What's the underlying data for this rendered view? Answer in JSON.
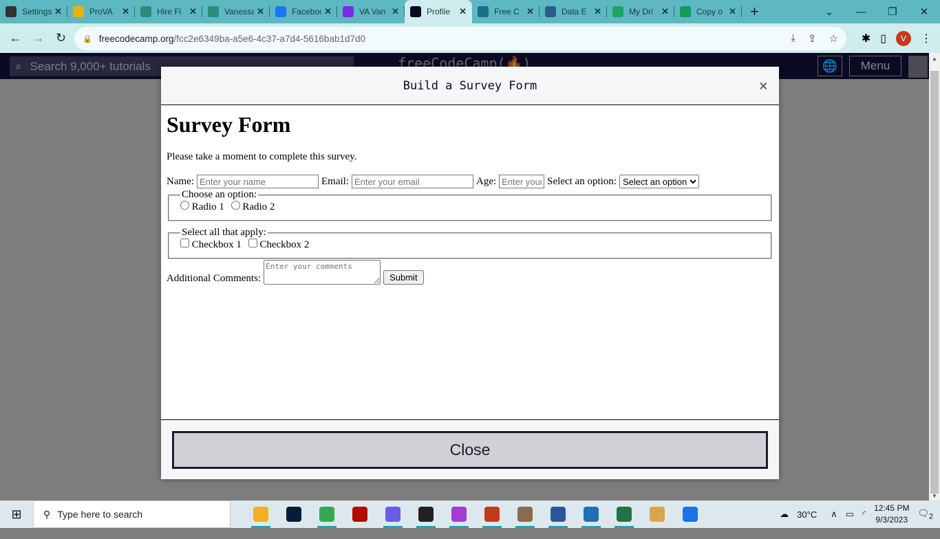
{
  "browser": {
    "tabs": [
      {
        "label": "Settings",
        "icon": "gear-icon",
        "color": "#333"
      },
      {
        "label": "ProVA",
        "icon": "prova-icon",
        "color": "#e8b400"
      },
      {
        "label": "Hire Fi",
        "icon": "pen-icon",
        "color": "#2a8c7a"
      },
      {
        "label": "Vanessa",
        "icon": "pen-icon",
        "color": "#2a8c7a"
      },
      {
        "label": "Facebook",
        "icon": "facebook-icon",
        "color": "#1877f2"
      },
      {
        "label": "VA Van",
        "icon": "canva-icon",
        "color": "#7d2ae8"
      },
      {
        "label": "Profile",
        "icon": "freecodecamp-icon",
        "color": "#0a0a23",
        "active": true
      },
      {
        "label": "Free C",
        "icon": "cisco-icon",
        "color": "#1b6f86"
      },
      {
        "label": "Data E",
        "icon": "data-icon",
        "color": "#2a5d8a"
      },
      {
        "label": "My Dri",
        "icon": "google-drive-icon",
        "color": "#1fa463"
      },
      {
        "label": "Copy o",
        "icon": "google-sheets-icon",
        "color": "#0f9d58"
      }
    ],
    "close_glyph": "✕",
    "new_tab": "+",
    "url_domain": "freecodecamp.org",
    "url_path": "/fcc2e6349ba-a5e6-4c37-a7d4-5616bab1d7d0",
    "profile_initial": "V"
  },
  "fcc_nav": {
    "search_placeholder": "Search 9,000+ tutorials",
    "logo": "freeCodeCamp(🔥)",
    "menu": "Menu"
  },
  "modal": {
    "title": "Build a Survey Form",
    "close_x": "×",
    "close_button": "Close",
    "form": {
      "heading": "Survey Form",
      "description": "Please take a moment to complete this survey.",
      "name_label": "Name:",
      "name_placeholder": "Enter your name",
      "email_label": "Email:",
      "email_placeholder": "Enter your email",
      "age_label": "Age:",
      "age_placeholder": "Enter your age",
      "select_label": "Select an option:",
      "select_value": "Select an option",
      "radio_legend": "Choose an option:",
      "radio1": "Radio 1",
      "radio2": "Radio 2",
      "checkbox_legend": "Select all that apply:",
      "checkbox1": "Checkbox 1",
      "checkbox2": "Checkbox 2",
      "comments_label": "Additional Comments:",
      "comments_placeholder": "Enter your comments",
      "submit": "Submit"
    }
  },
  "taskbar": {
    "search_placeholder": "Type here to search",
    "apps": [
      {
        "name": "file-explorer",
        "color": "#f2b01e",
        "on": true
      },
      {
        "name": "photoshop",
        "color": "#001e36",
        "on": false
      },
      {
        "name": "chrome",
        "color": "#34a853",
        "on": true
      },
      {
        "name": "acrobat",
        "color": "#b30b00",
        "on": false
      },
      {
        "name": "copilot",
        "color": "#6b5ce7",
        "on": true
      },
      {
        "name": "sticky-notes",
        "color": "#222",
        "on": true
      },
      {
        "name": "messenger",
        "color": "#a33bd6",
        "on": true
      },
      {
        "name": "chrome-profile-v",
        "color": "#c5391c",
        "on": true
      },
      {
        "name": "chrome-profile-2",
        "color": "#8a6a50",
        "on": true
      },
      {
        "name": "word",
        "color": "#2b579a",
        "on": true
      },
      {
        "name": "photos",
        "color": "#1e6fb8",
        "on": true
      },
      {
        "name": "excel",
        "color": "#217346",
        "on": true
      },
      {
        "name": "paint",
        "color": "#d9a54a",
        "on": false
      },
      {
        "name": "help",
        "color": "#1a73e8",
        "on": false
      }
    ],
    "weather": "30°C",
    "time": "12:45 PM",
    "date": "9/3/2023",
    "notifications": "2"
  }
}
